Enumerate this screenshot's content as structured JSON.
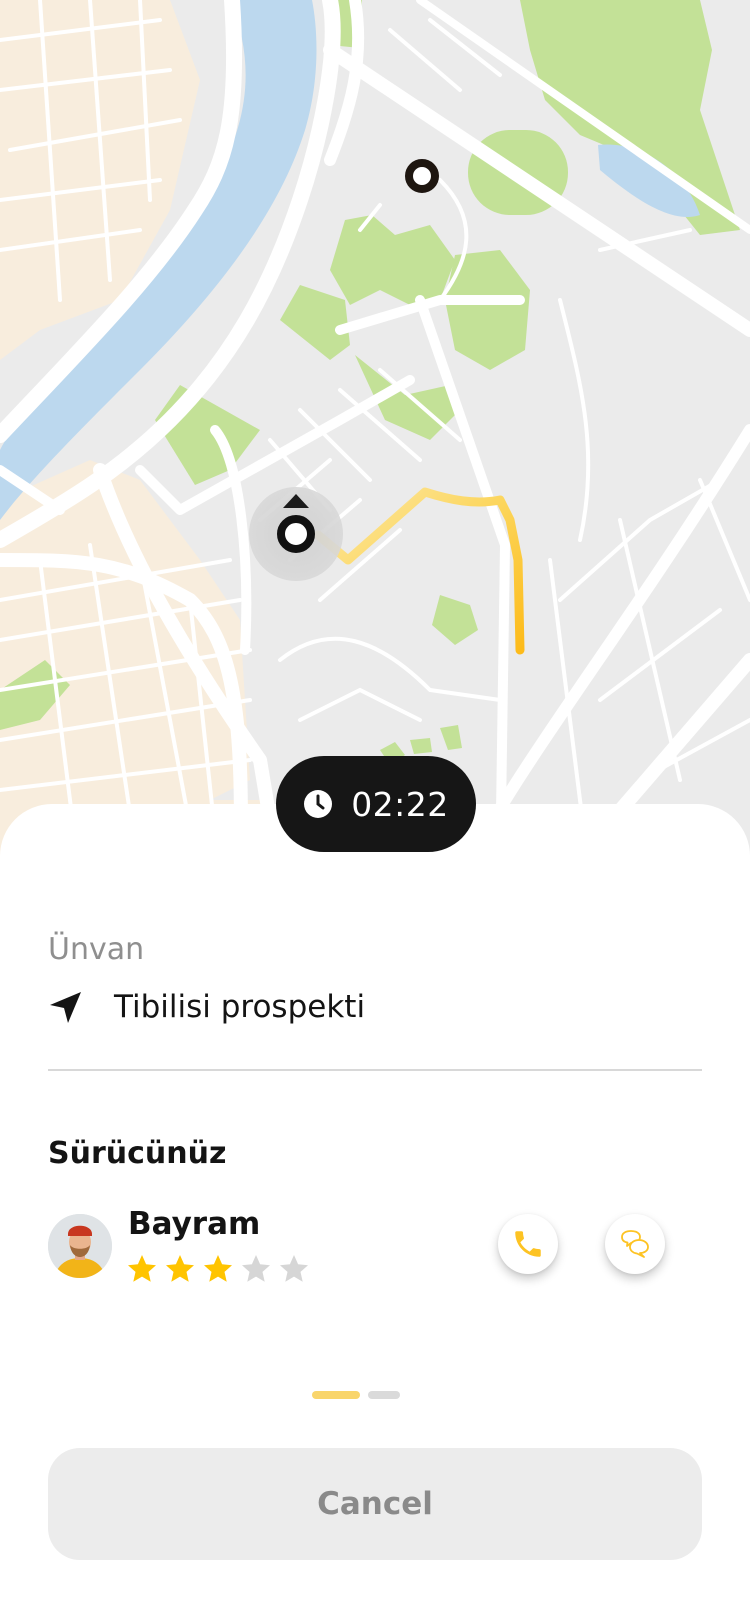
{
  "map": {
    "pickup_icon": "pickup-marker-icon",
    "car_icon": "navigation-arrow-icon",
    "route_color": "#FDC323",
    "colors": {
      "land": "#ebebeb",
      "road": "#ffffff",
      "park": "#c3e197",
      "water": "#bcd8ee",
      "residential": "#f8eddd"
    }
  },
  "timer": {
    "icon": "clock-icon",
    "value": "02:22"
  },
  "destination": {
    "label": "Ünvan",
    "icon": "navigation-arrow-icon",
    "value": "Tibilisi prospekti"
  },
  "driver": {
    "section_title": "Sürücünüz",
    "name": "Bayram",
    "rating": 3,
    "rating_max": 5,
    "star_color": "#FFC400",
    "star_empty_color": "#d6d6d6",
    "call_icon": "phone-icon",
    "chat_icon": "chat-bubbles-icon"
  },
  "pager": {
    "pages": 2,
    "active": 1,
    "active_color": "#f9d56b"
  },
  "cancel": {
    "label": "Cancel"
  }
}
